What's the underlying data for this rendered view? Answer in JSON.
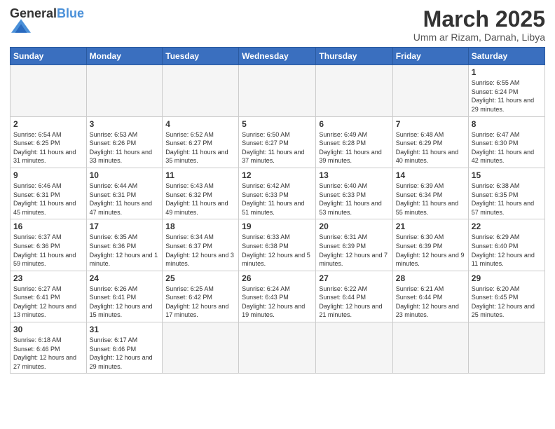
{
  "logo": {
    "text_general": "General",
    "text_blue": "Blue"
  },
  "header": {
    "title": "March 2025",
    "subtitle": "Umm ar Rizam, Darnah, Libya"
  },
  "weekdays": [
    "Sunday",
    "Monday",
    "Tuesday",
    "Wednesday",
    "Thursday",
    "Friday",
    "Saturday"
  ],
  "weeks": [
    [
      {
        "day": "",
        "info": ""
      },
      {
        "day": "",
        "info": ""
      },
      {
        "day": "",
        "info": ""
      },
      {
        "day": "",
        "info": ""
      },
      {
        "day": "",
        "info": ""
      },
      {
        "day": "",
        "info": ""
      },
      {
        "day": "1",
        "info": "Sunrise: 6:55 AM\nSunset: 6:24 PM\nDaylight: 11 hours and 29 minutes."
      }
    ],
    [
      {
        "day": "2",
        "info": "Sunrise: 6:54 AM\nSunset: 6:25 PM\nDaylight: 11 hours and 31 minutes."
      },
      {
        "day": "3",
        "info": "Sunrise: 6:53 AM\nSunset: 6:26 PM\nDaylight: 11 hours and 33 minutes."
      },
      {
        "day": "4",
        "info": "Sunrise: 6:52 AM\nSunset: 6:27 PM\nDaylight: 11 hours and 35 minutes."
      },
      {
        "day": "5",
        "info": "Sunrise: 6:50 AM\nSunset: 6:27 PM\nDaylight: 11 hours and 37 minutes."
      },
      {
        "day": "6",
        "info": "Sunrise: 6:49 AM\nSunset: 6:28 PM\nDaylight: 11 hours and 39 minutes."
      },
      {
        "day": "7",
        "info": "Sunrise: 6:48 AM\nSunset: 6:29 PM\nDaylight: 11 hours and 40 minutes."
      },
      {
        "day": "8",
        "info": "Sunrise: 6:47 AM\nSunset: 6:30 PM\nDaylight: 11 hours and 42 minutes."
      }
    ],
    [
      {
        "day": "9",
        "info": "Sunrise: 6:46 AM\nSunset: 6:31 PM\nDaylight: 11 hours and 45 minutes."
      },
      {
        "day": "10",
        "info": "Sunrise: 6:44 AM\nSunset: 6:31 PM\nDaylight: 11 hours and 47 minutes."
      },
      {
        "day": "11",
        "info": "Sunrise: 6:43 AM\nSunset: 6:32 PM\nDaylight: 11 hours and 49 minutes."
      },
      {
        "day": "12",
        "info": "Sunrise: 6:42 AM\nSunset: 6:33 PM\nDaylight: 11 hours and 51 minutes."
      },
      {
        "day": "13",
        "info": "Sunrise: 6:40 AM\nSunset: 6:33 PM\nDaylight: 11 hours and 53 minutes."
      },
      {
        "day": "14",
        "info": "Sunrise: 6:39 AM\nSunset: 6:34 PM\nDaylight: 11 hours and 55 minutes."
      },
      {
        "day": "15",
        "info": "Sunrise: 6:38 AM\nSunset: 6:35 PM\nDaylight: 11 hours and 57 minutes."
      }
    ],
    [
      {
        "day": "16",
        "info": "Sunrise: 6:37 AM\nSunset: 6:36 PM\nDaylight: 11 hours and 59 minutes."
      },
      {
        "day": "17",
        "info": "Sunrise: 6:35 AM\nSunset: 6:36 PM\nDaylight: 12 hours and 1 minute."
      },
      {
        "day": "18",
        "info": "Sunrise: 6:34 AM\nSunset: 6:37 PM\nDaylight: 12 hours and 3 minutes."
      },
      {
        "day": "19",
        "info": "Sunrise: 6:33 AM\nSunset: 6:38 PM\nDaylight: 12 hours and 5 minutes."
      },
      {
        "day": "20",
        "info": "Sunrise: 6:31 AM\nSunset: 6:39 PM\nDaylight: 12 hours and 7 minutes."
      },
      {
        "day": "21",
        "info": "Sunrise: 6:30 AM\nSunset: 6:39 PM\nDaylight: 12 hours and 9 minutes."
      },
      {
        "day": "22",
        "info": "Sunrise: 6:29 AM\nSunset: 6:40 PM\nDaylight: 12 hours and 11 minutes."
      }
    ],
    [
      {
        "day": "23",
        "info": "Sunrise: 6:27 AM\nSunset: 6:41 PM\nDaylight: 12 hours and 13 minutes."
      },
      {
        "day": "24",
        "info": "Sunrise: 6:26 AM\nSunset: 6:41 PM\nDaylight: 12 hours and 15 minutes."
      },
      {
        "day": "25",
        "info": "Sunrise: 6:25 AM\nSunset: 6:42 PM\nDaylight: 12 hours and 17 minutes."
      },
      {
        "day": "26",
        "info": "Sunrise: 6:24 AM\nSunset: 6:43 PM\nDaylight: 12 hours and 19 minutes."
      },
      {
        "day": "27",
        "info": "Sunrise: 6:22 AM\nSunset: 6:44 PM\nDaylight: 12 hours and 21 minutes."
      },
      {
        "day": "28",
        "info": "Sunrise: 6:21 AM\nSunset: 6:44 PM\nDaylight: 12 hours and 23 minutes."
      },
      {
        "day": "29",
        "info": "Sunrise: 6:20 AM\nSunset: 6:45 PM\nDaylight: 12 hours and 25 minutes."
      }
    ],
    [
      {
        "day": "30",
        "info": "Sunrise: 6:18 AM\nSunset: 6:46 PM\nDaylight: 12 hours and 27 minutes."
      },
      {
        "day": "31",
        "info": "Sunrise: 6:17 AM\nSunset: 6:46 PM\nDaylight: 12 hours and 29 minutes."
      },
      {
        "day": "",
        "info": ""
      },
      {
        "day": "",
        "info": ""
      },
      {
        "day": "",
        "info": ""
      },
      {
        "day": "",
        "info": ""
      },
      {
        "day": "",
        "info": ""
      }
    ]
  ]
}
